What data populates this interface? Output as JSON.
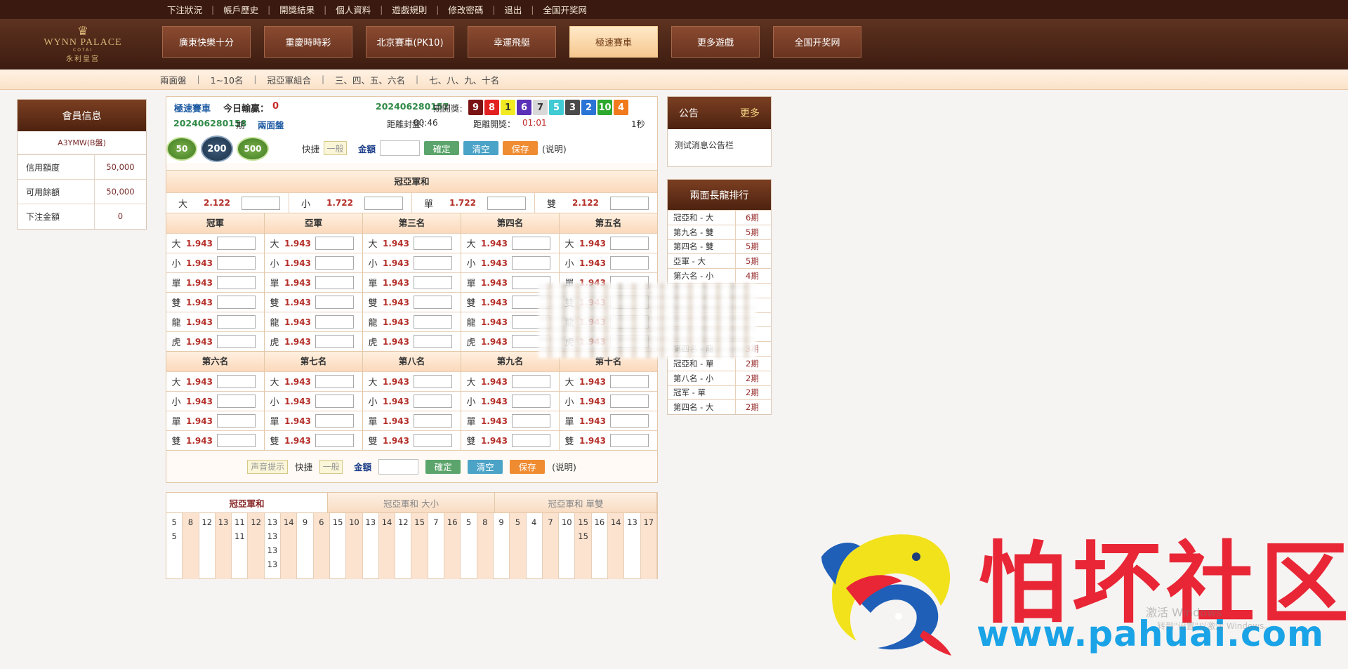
{
  "topnav": [
    "下注狀況",
    "帳戶歷史",
    "開獎結果",
    "個人資料",
    "遊戲規則",
    "修改密碼",
    "退出",
    "全国开奖网"
  ],
  "logo": {
    "line1": "WYNN PALACE",
    "line2": "COTAI",
    "line3": "永利皇宫"
  },
  "games": [
    {
      "label": "廣東快樂十分",
      "active": false
    },
    {
      "label": "重慶時時彩",
      "active": false
    },
    {
      "label": "北京賽車(PK10)",
      "active": false
    },
    {
      "label": "幸運飛艇",
      "active": false
    },
    {
      "label": "極速賽車",
      "active": true
    },
    {
      "label": "更多遊戲",
      "active": false
    },
    {
      "label": "全国开奖网",
      "active": false
    }
  ],
  "subnav": [
    "兩面盤",
    "1~10名",
    "冠亞軍組合",
    "三、四、五、六名",
    "七、八、九、十名"
  ],
  "member": {
    "title": "會員信息",
    "account": "A3YMW(B盤)",
    "rows": [
      {
        "label": "信用額度",
        "value": "50,000"
      },
      {
        "label": "可用餘額",
        "value": "50,000"
      },
      {
        "label": "下注金額",
        "value": "0"
      }
    ]
  },
  "info": {
    "lotto": "極速賽車",
    "today_label": "今日輸贏：",
    "today_value": "0",
    "last_draw": "202406280157",
    "last_draw_label": "期開獎:",
    "balls": [
      {
        "n": "9",
        "c": "#7a1414"
      },
      {
        "n": "8",
        "c": "#e32020"
      },
      {
        "n": "1",
        "c": "#f1ea22"
      },
      {
        "n": "6",
        "c": "#5a30b8"
      },
      {
        "n": "7",
        "c": "#d8d8d8"
      },
      {
        "n": "5",
        "c": "#3fcad4"
      },
      {
        "n": "3",
        "c": "#4a4a4a"
      },
      {
        "n": "2",
        "c": "#2a74d6"
      },
      {
        "n": "10",
        "c": "#2daa2d"
      },
      {
        "n": "4",
        "c": "#f07a1c"
      }
    ],
    "current": "202406280158",
    "current_label": "期",
    "current_type": "兩面盤",
    "close_label": "距離封盤：",
    "close_time": "00:46",
    "open_label": "距離開獎：",
    "open_time": "01:01",
    "refresh": "1秒"
  },
  "chips": [
    "50",
    "200",
    "500"
  ],
  "quick": {
    "label": "快捷",
    "normal": "一般",
    "amount": "金額",
    "confirm": "確定",
    "clear": "清空",
    "save": "保存",
    "explain": "(说明)",
    "sound": "声音提示"
  },
  "gy": {
    "title": "冠亞軍和",
    "items": [
      {
        "label": "大",
        "odds": "2.122"
      },
      {
        "label": "小",
        "odds": "1.722"
      },
      {
        "label": "單",
        "odds": "1.722"
      },
      {
        "label": "雙",
        "odds": "2.122"
      }
    ]
  },
  "positions_top": [
    {
      "name": "冠軍"
    },
    {
      "name": "亞軍"
    },
    {
      "name": "第三名"
    },
    {
      "name": "第四名"
    },
    {
      "name": "第五名"
    }
  ],
  "positions_bottom": [
    {
      "name": "第六名"
    },
    {
      "name": "第七名"
    },
    {
      "name": "第八名"
    },
    {
      "name": "第九名"
    },
    {
      "name": "第十名"
    }
  ],
  "bet_labels_6": [
    "大",
    "小",
    "單",
    "雙",
    "龍",
    "虎"
  ],
  "bet_labels_4": [
    "大",
    "小",
    "單",
    "雙"
  ],
  "odds": "1.943",
  "stats": {
    "tabs": [
      "冠亞軍和",
      "冠亞軍和 大小",
      "冠亞軍和 單雙"
    ],
    "columns": [
      [
        "5",
        "5"
      ],
      [
        "8"
      ],
      [
        "12"
      ],
      [
        "13"
      ],
      [
        "11",
        "11"
      ],
      [
        "12"
      ],
      [
        "13",
        "13",
        "13",
        "13"
      ],
      [
        "14"
      ],
      [
        "9"
      ],
      [
        "6"
      ],
      [
        "15"
      ],
      [
        "10"
      ],
      [
        "13"
      ],
      [
        "14"
      ],
      [
        "12"
      ],
      [
        "15"
      ],
      [
        "7"
      ],
      [
        "16"
      ],
      [
        "5"
      ],
      [
        "8"
      ],
      [
        "9"
      ],
      [
        "5"
      ],
      [
        "4"
      ],
      [
        "7"
      ],
      [
        "10"
      ],
      [
        "15",
        "15"
      ],
      [
        "16"
      ],
      [
        "14"
      ],
      [
        "13"
      ],
      [
        "17"
      ]
    ]
  },
  "notice": {
    "title": "公告",
    "more": "更多",
    "text": "测试消息公告栏"
  },
  "dragon": {
    "title": "兩面長龍排行",
    "rows": [
      {
        "name": "冠亞和 - 大",
        "period": "6期"
      },
      {
        "name": "第九名 - 雙",
        "period": "5期"
      },
      {
        "name": "第四名 - 雙",
        "period": "5期"
      },
      {
        "name": "亞軍  - 大",
        "period": "5期"
      },
      {
        "name": "第六名 - 小",
        "period": "4期"
      },
      {
        "name": "",
        "period": ""
      },
      {
        "name": "",
        "period": ""
      },
      {
        "name": "",
        "period": ""
      },
      {
        "name": "",
        "period": ""
      },
      {
        "name": "第四名 - 龍",
        "period": "3期"
      },
      {
        "name": "冠亞和 - 單",
        "period": "2期"
      },
      {
        "name": "第八名 - 小",
        "period": "2期"
      },
      {
        "name": "冠军  - 單",
        "period": "2期"
      },
      {
        "name": "第四名 - 大",
        "period": "2期"
      }
    ]
  },
  "watermark": {
    "cn": "怕坏社区",
    "url": "www.pahuai.com"
  },
  "windows": {
    "line1": "激活 Windows",
    "line2": "转到\"设置\"以激活 Windows。"
  }
}
